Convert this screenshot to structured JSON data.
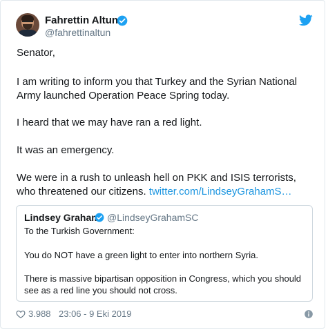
{
  "author": {
    "name": "Fahrettin Altun",
    "handle": "@fahrettinaltun"
  },
  "tweet": {
    "greeting": "Senator,",
    "paragraph_2": "I am writing to inform you that Turkey and the Syrian National Army launched Operation Peace Spring today.",
    "paragraph_3": "I heard that we may have ran a red light.",
    "paragraph_4": "It was an emergency.",
    "paragraph_5": "We were in a rush to unleash hell on PKK and ISIS terrorists, who threatened our citizens.",
    "link_text": "twitter.com/LindseyGrahamS…"
  },
  "quoted_tweet": {
    "name": "Lindsey Graham",
    "handle": "@LindseyGrahamSC",
    "line_1": "To the Turkish Government:",
    "line_2": "You do NOT have a green light to enter into northern Syria.",
    "line_3": "There is massive bipartisan opposition in Congress, which you should see as a red line you should not cross."
  },
  "footer": {
    "likes": "3.988",
    "timestamp": "23:06 - 9 Eki 2019"
  },
  "icons": {
    "brand": "twitter-bird-icon",
    "verified": "verified-badge-icon",
    "like": "heart-icon",
    "info": "info-icon"
  },
  "colors": {
    "brand_blue": "#1da1f2",
    "link": "#1b95e0",
    "secondary_text": "#657786",
    "border": "#e1e8ed"
  }
}
